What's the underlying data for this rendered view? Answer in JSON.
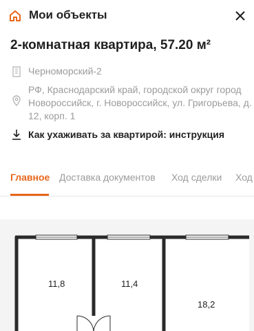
{
  "header": {
    "title": "Мои объекты"
  },
  "property": {
    "title": "2-комнатная квартира, 57.20 м²",
    "complex": "Черноморский-2",
    "address": "РФ, Краснодарский край, городской округ город Новороссийск, г. Новороссийск, ул. Григорьева, д. 12, корп. 1",
    "instruction_link": "Как ухаживать за квартирой: инструкция"
  },
  "tabs": [
    {
      "label": "Главное",
      "active": true
    },
    {
      "label": "Доставка документов",
      "active": false
    },
    {
      "label": "Ход сделки",
      "active": false
    },
    {
      "label": "Ход",
      "active": false
    }
  ],
  "floor_plan": {
    "rooms": [
      {
        "area": "11,8"
      },
      {
        "area": "11,4"
      },
      {
        "area": "18,2"
      }
    ]
  },
  "colors": {
    "accent": "#e8661a",
    "muted": "#9b9b9b",
    "text": "#1f1f1f"
  }
}
